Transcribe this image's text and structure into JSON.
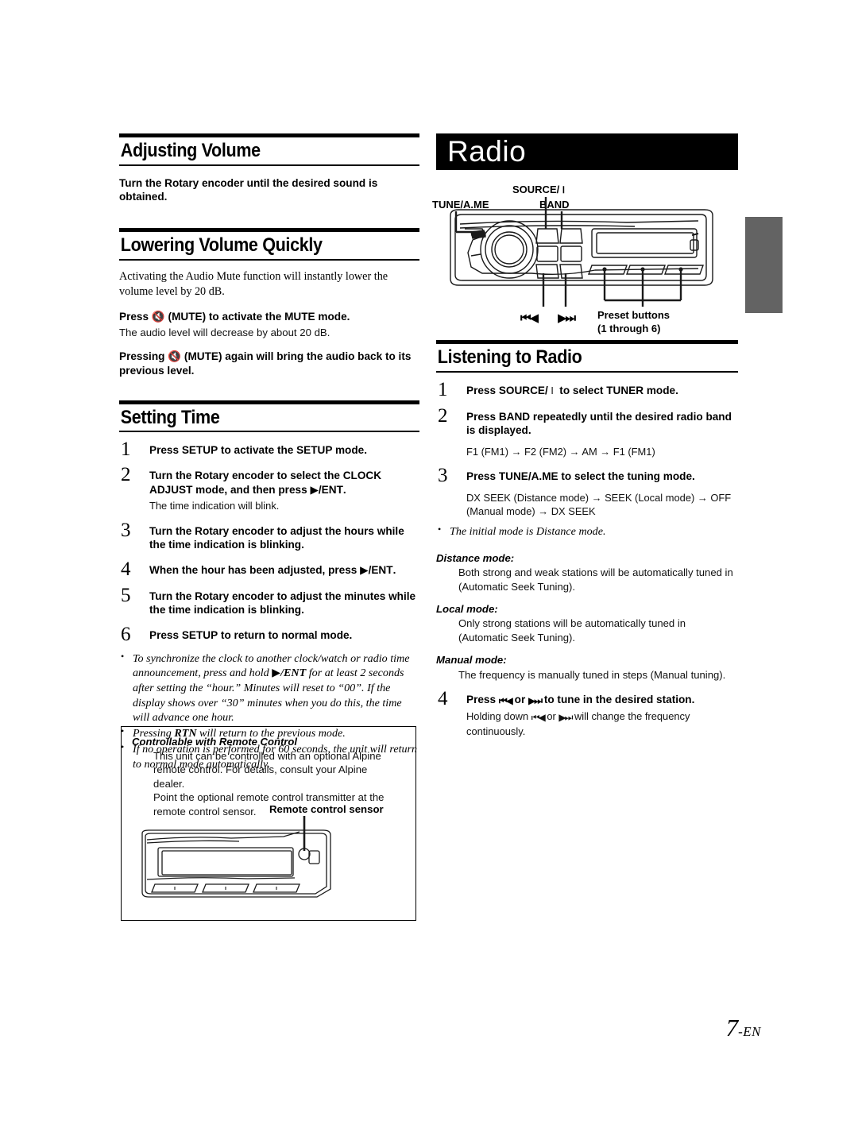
{
  "page": {
    "number_label": "7",
    "lang_suffix": "-EN"
  },
  "left_column": {
    "section_adjusting_volume": {
      "heading": "Adjusting Volume",
      "instruction_prefix": "Turn the ",
      "instruction_bold": "Rotary encoder",
      "instruction_suffix": " until the desired sound is obtained."
    },
    "section_lowering_volume": {
      "heading": "Lowering Volume Quickly",
      "intro": "Activating the Audio Mute function will instantly lower the volume level by 20 dB.",
      "press_mute_pre": "Press ",
      "press_mute_key": "(MUTE)",
      "press_mute_post": " to activate the MUTE mode.",
      "press_mute_sub": "The audio level will decrease by about 20 dB.",
      "press_again_pre": "Pressing ",
      "press_again_key": "(MUTE)",
      "press_again_post": " again will bring the audio back to its previous level.",
      "mute_icon": "mute-speaker-icon"
    },
    "section_setting_time": {
      "heading": "Setting Time",
      "steps": [
        {
          "num": "1",
          "head_pre": "Press ",
          "head_key": "SETUP",
          "head_post": " to activate the SETUP mode.",
          "sub": ""
        },
        {
          "num": "2",
          "head_pre": "Turn the ",
          "head_key": "Rotary encoder",
          "head_post": " to select the CLOCK ADJUST mode, and then press ",
          "head_key2": "/ENT",
          "head_post2": ".",
          "sub": "The time indication will blink."
        },
        {
          "num": "3",
          "head_pre": "Turn the ",
          "head_key": "Rotary encoder",
          "head_post": " to adjust the hours while the time indication is blinking.",
          "sub": ""
        },
        {
          "num": "4",
          "head_pre": "When the hour has been adjusted, press ",
          "head_key": "",
          "head_post": "",
          "head_key2": "/ENT",
          "head_post2": ".",
          "sub": ""
        },
        {
          "num": "5",
          "head_pre": "Turn the ",
          "head_key": "Rotary encoder",
          "head_post": " to adjust the minutes while the time indication is blinking.",
          "sub": ""
        },
        {
          "num": "6",
          "head_pre": "Press ",
          "head_key": "SETUP",
          "head_post": " to return to normal mode.",
          "sub": ""
        }
      ],
      "notes": [
        {
          "pre": "To synchronize the clock to another clock/watch or radio time announcement, press and hold ",
          "key": "/ENT",
          "post": " for at least 2 seconds after setting the “hour.” Minutes will reset to “00”. If the display shows over “30” minutes when you do this, the time will advance one hour."
        },
        {
          "pre": "Pressing ",
          "key": "RTN",
          "post": " will return to the previous mode."
        },
        {
          "pre": "If no operation is performed for 60 seconds, the unit will return to normal mode automatically.",
          "key": "",
          "post": ""
        }
      ]
    },
    "remote_box": {
      "title": "Controllable with Remote Control",
      "body_line1": "This unit can be controlled with an optional Alpine remote control. For details, consult your Alpine dealer.",
      "body_line2": "Point the optional remote control transmitter at the remote control sensor.",
      "sensor_label": "Remote control sensor"
    }
  },
  "right_column": {
    "chapter_banner": "Radio",
    "device_diagram": {
      "labels": {
        "tune_ame": "TUNE/A.ME",
        "source_power": "SOURCE/",
        "band": "BAND",
        "prev": "prev-track-icon",
        "next": "next-track-icon",
        "preset_line1": "Preset buttons",
        "preset_line2": "(1 through 6)"
      }
    },
    "section_listening": {
      "heading": "Listening to Radio",
      "steps": [
        {
          "num": "1",
          "head_pre": "Press ",
          "head_key": "SOURCE/",
          "head_post": " to select TUNER mode.",
          "sub": "",
          "seq": ""
        },
        {
          "num": "2",
          "head_pre": "Press ",
          "head_key": "BAND",
          "head_post": " repeatedly until the desired radio band is displayed.",
          "sub": "",
          "seq": "F1 (FM1) → F2 (FM2) → AM → F1 (FM1)"
        },
        {
          "num": "3",
          "head_pre": "Press ",
          "head_key": "TUNE/A.ME",
          "head_post": " to select the tuning mode.",
          "sub": "",
          "seq": "DX SEEK (Distance mode) → SEEK (Local mode) → OFF (Manual mode) → DX SEEK"
        }
      ],
      "initial_mode_note": "The initial mode is Distance mode.",
      "modes": [
        {
          "title": "Distance mode:",
          "body": "Both strong and weak stations will be automatically tuned in (Automatic Seek Tuning)."
        },
        {
          "title": "Local mode:",
          "body": "Only strong stations will be automatically tuned in (Automatic Seek Tuning)."
        },
        {
          "title": "Manual mode:",
          "body": "The frequency is manually tuned in steps (Manual tuning)."
        }
      ],
      "step4": {
        "num": "4",
        "head_pre": "Press ",
        "head_mid": " or ",
        "head_post": " to tune in the desired station.",
        "sub_pre": "Holding down ",
        "sub_mid": " or ",
        "sub_post": " will change the frequency continuously."
      }
    }
  },
  "colors": {
    "thumb_tab": "#636363",
    "banner_bg": "#000000",
    "rule": "#000000"
  }
}
